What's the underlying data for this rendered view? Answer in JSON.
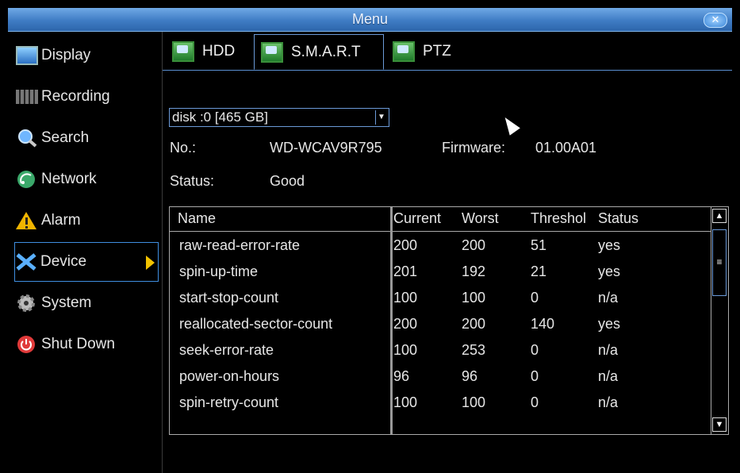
{
  "window": {
    "title": "Menu",
    "close_icon": "close-icon"
  },
  "sidebar": {
    "items": [
      {
        "label": "Display",
        "icon": "display-icon"
      },
      {
        "label": "Recording",
        "icon": "recording-icon"
      },
      {
        "label": "Search",
        "icon": "search-icon"
      },
      {
        "label": "Network",
        "icon": "network-icon"
      },
      {
        "label": "Alarm",
        "icon": "alarm-icon"
      },
      {
        "label": "Device",
        "icon": "device-icon"
      },
      {
        "label": "System",
        "icon": "gear-icon"
      },
      {
        "label": "Shut Down",
        "icon": "power-icon"
      }
    ],
    "active": "Device"
  },
  "tabs": [
    {
      "label": "HDD"
    },
    {
      "label": "S.M.A.R.T"
    },
    {
      "label": "PTZ"
    }
  ],
  "active_tab": "S.M.A.R.T",
  "disk": {
    "selected": "disk :0 [465 GB]"
  },
  "info": {
    "no_label": "No.:",
    "no_value": "WD-WCAV9R795",
    "firmware_label": "Firmware:",
    "firmware_value": "01.00A01",
    "status_label": "Status:",
    "status_value": "Good"
  },
  "table": {
    "headers": [
      "Name",
      "Current",
      "Worst",
      "Threshol",
      "Status"
    ],
    "rows": [
      [
        "raw-read-error-rate",
        "200",
        "200",
        "51",
        "yes"
      ],
      [
        "spin-up-time",
        "201",
        "192",
        "21",
        "yes"
      ],
      [
        "start-stop-count",
        "100",
        "100",
        "0",
        "n/a"
      ],
      [
        "reallocated-sector-count",
        "200",
        "200",
        "140",
        "yes"
      ],
      [
        "seek-error-rate",
        "100",
        "253",
        "0",
        "n/a"
      ],
      [
        "power-on-hours",
        "96",
        "96",
        "0",
        "n/a"
      ],
      [
        "spin-retry-count",
        "100",
        "100",
        "0",
        "n/a"
      ]
    ]
  },
  "colors": {
    "accent": "#3f7cc4",
    "highlight_border": "#3f8ee0",
    "arrow": "#f2c200"
  }
}
